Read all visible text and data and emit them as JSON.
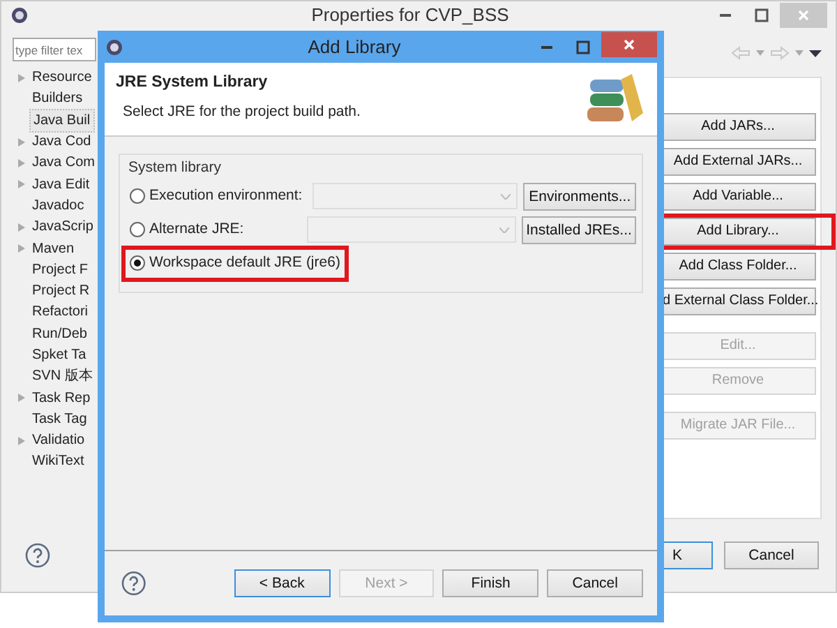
{
  "window": {
    "title": "Properties for CVP_BSS"
  },
  "filter": {
    "placeholder": "type filter tex"
  },
  "tree": [
    {
      "label": "Resource",
      "expandable": true,
      "selected": false
    },
    {
      "label": "Builders",
      "expandable": false,
      "selected": false
    },
    {
      "label": "Java Buil",
      "expandable": false,
      "selected": true
    },
    {
      "label": "Java Cod",
      "expandable": true,
      "selected": false
    },
    {
      "label": "Java Com",
      "expandable": true,
      "selected": false
    },
    {
      "label": "Java Edit",
      "expandable": true,
      "selected": false
    },
    {
      "label": "Javadoc",
      "expandable": false,
      "selected": false
    },
    {
      "label": "JavaScrip",
      "expandable": true,
      "selected": false
    },
    {
      "label": "Maven",
      "expandable": true,
      "selected": false
    },
    {
      "label": "Project F",
      "expandable": false,
      "selected": false
    },
    {
      "label": "Project R",
      "expandable": false,
      "selected": false
    },
    {
      "label": "Refactori",
      "expandable": false,
      "selected": false
    },
    {
      "label": "Run/Deb",
      "expandable": false,
      "selected": false
    },
    {
      "label": "Spket Ta",
      "expandable": false,
      "selected": false
    },
    {
      "label": "SVN 版本",
      "expandable": false,
      "selected": false
    },
    {
      "label": "Task Rep",
      "expandable": true,
      "selected": false
    },
    {
      "label": "Task Tag",
      "expandable": false,
      "selected": false
    },
    {
      "label": "Validatio",
      "expandable": true,
      "selected": false
    },
    {
      "label": "WikiText",
      "expandable": false,
      "selected": false
    }
  ],
  "side_button_groups": [
    [
      {
        "label": "Add JARs...",
        "disabled": false,
        "highlighted": false
      },
      {
        "label": "Add External JARs...",
        "disabled": false,
        "highlighted": false
      },
      {
        "label": "Add Variable...",
        "disabled": false,
        "highlighted": false
      },
      {
        "label": "Add Library...",
        "disabled": false,
        "highlighted": true
      },
      {
        "label": "Add Class Folder...",
        "disabled": false,
        "highlighted": false
      },
      {
        "label": "d External Class Folder...",
        "disabled": false,
        "highlighted": false
      }
    ],
    [
      {
        "label": "Edit...",
        "disabled": true,
        "highlighted": false
      },
      {
        "label": "Remove",
        "disabled": true,
        "highlighted": false
      }
    ],
    [
      {
        "label": "Migrate JAR File...",
        "disabled": true,
        "highlighted": false
      }
    ]
  ],
  "footer_buttons": [
    {
      "label": "K",
      "default": true
    },
    {
      "label": "Cancel",
      "default": false
    }
  ],
  "dialog": {
    "title": "Add Library",
    "heading": "JRE System Library",
    "description": "Select JRE for the project build path.",
    "group": {
      "title": "System library",
      "options": [
        {
          "label": "Execution environment:",
          "selected": false,
          "highlighted": false,
          "kind": "combo",
          "button": "Environments..."
        },
        {
          "label": "Alternate JRE:",
          "selected": false,
          "highlighted": false,
          "kind": "combo",
          "button": "Installed JREs..."
        },
        {
          "label": "Workspace default JRE (jre6)",
          "selected": true,
          "highlighted": true,
          "kind": "plain"
        }
      ]
    },
    "buttons": [
      {
        "label": "< Back",
        "disabled": false,
        "default": true
      },
      {
        "label": "Next >",
        "disabled": true,
        "default": false
      },
      {
        "label": "Finish",
        "disabled": false,
        "default": false
      },
      {
        "label": "Cancel",
        "disabled": false,
        "default": false
      }
    ]
  }
}
